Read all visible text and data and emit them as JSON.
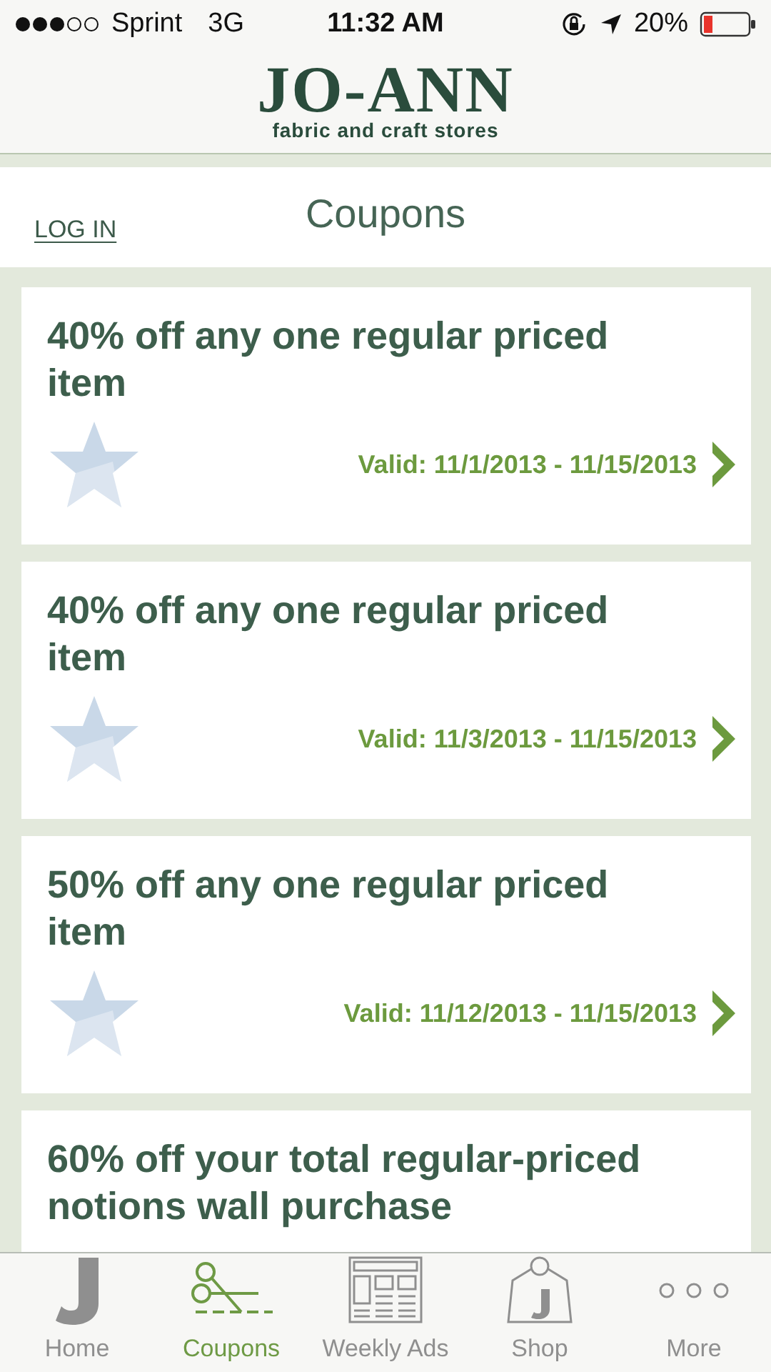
{
  "status_bar": {
    "carrier": "Sprint",
    "network": "3G",
    "time": "11:32 AM",
    "battery": "20%"
  },
  "header": {
    "logo_name": "JO-ANN",
    "logo_tagline": "fabric and craft stores"
  },
  "title_bar": {
    "login": "LOG IN",
    "title": "Coupons"
  },
  "coupons": [
    {
      "title": "40% off any one regular priced item",
      "valid": "Valid: 11/1/2013 - 11/15/2013",
      "starred": false
    },
    {
      "title": "40% off any one regular priced item",
      "valid": "Valid: 11/3/2013 - 11/15/2013",
      "starred": false
    },
    {
      "title": "50% off any one regular priced item",
      "valid": "Valid: 11/12/2013 - 11/15/2013",
      "starred": false
    },
    {
      "title": "60% off your total regular-priced notions wall purchase"
    }
  ],
  "tab_bar": [
    {
      "kind": "home",
      "label": "Home",
      "selected": false
    },
    {
      "kind": "coupons",
      "label": "Coupons",
      "selected": true
    },
    {
      "kind": "ads",
      "label": "Weekly Ads",
      "selected": false
    },
    {
      "kind": "shop",
      "label": "Shop",
      "selected": false
    },
    {
      "kind": "more",
      "label": "More",
      "selected": false
    }
  ]
}
